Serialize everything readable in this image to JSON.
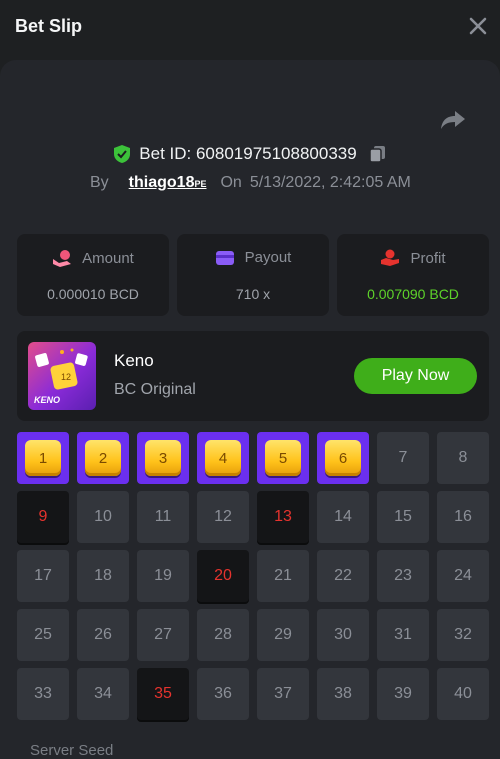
{
  "header": {
    "title": "Bet Slip"
  },
  "bet": {
    "id_label": "Bet ID: 60801975108800339",
    "by_label": "By",
    "user": "thiago18",
    "user_badge": "PE",
    "on_label": "On",
    "datetime": "5/13/2022, 2:42:05 AM"
  },
  "stats": {
    "amount": {
      "label": "Amount",
      "value": "0.000010 BCD"
    },
    "payout": {
      "label": "Payout",
      "value": "710 x"
    },
    "profit": {
      "label": "Profit",
      "value": "0.007090 BCD"
    }
  },
  "game": {
    "name": "Keno",
    "subtitle": "BC Original",
    "thumb_text": "KENO",
    "play_label": "Play Now"
  },
  "grid": {
    "cells": [
      "1",
      "2",
      "3",
      "4",
      "5",
      "6",
      "7",
      "8",
      "9",
      "10",
      "11",
      "12",
      "13",
      "14",
      "15",
      "16",
      "17",
      "18",
      "19",
      "20",
      "21",
      "22",
      "23",
      "24",
      "25",
      "26",
      "27",
      "28",
      "29",
      "30",
      "31",
      "32",
      "33",
      "34",
      "35",
      "36",
      "37",
      "38",
      "39",
      "40"
    ],
    "picked": [
      1,
      2,
      3,
      4,
      5,
      6
    ],
    "hits": [
      9,
      13,
      20,
      35
    ]
  },
  "footer": {
    "server_seed_label": "Server Seed"
  },
  "colors": {
    "accent_purple": "#6b2ff0",
    "win_green": "#5ed32a",
    "hit_red": "#e5332e",
    "play_green": "#3fae1a"
  }
}
